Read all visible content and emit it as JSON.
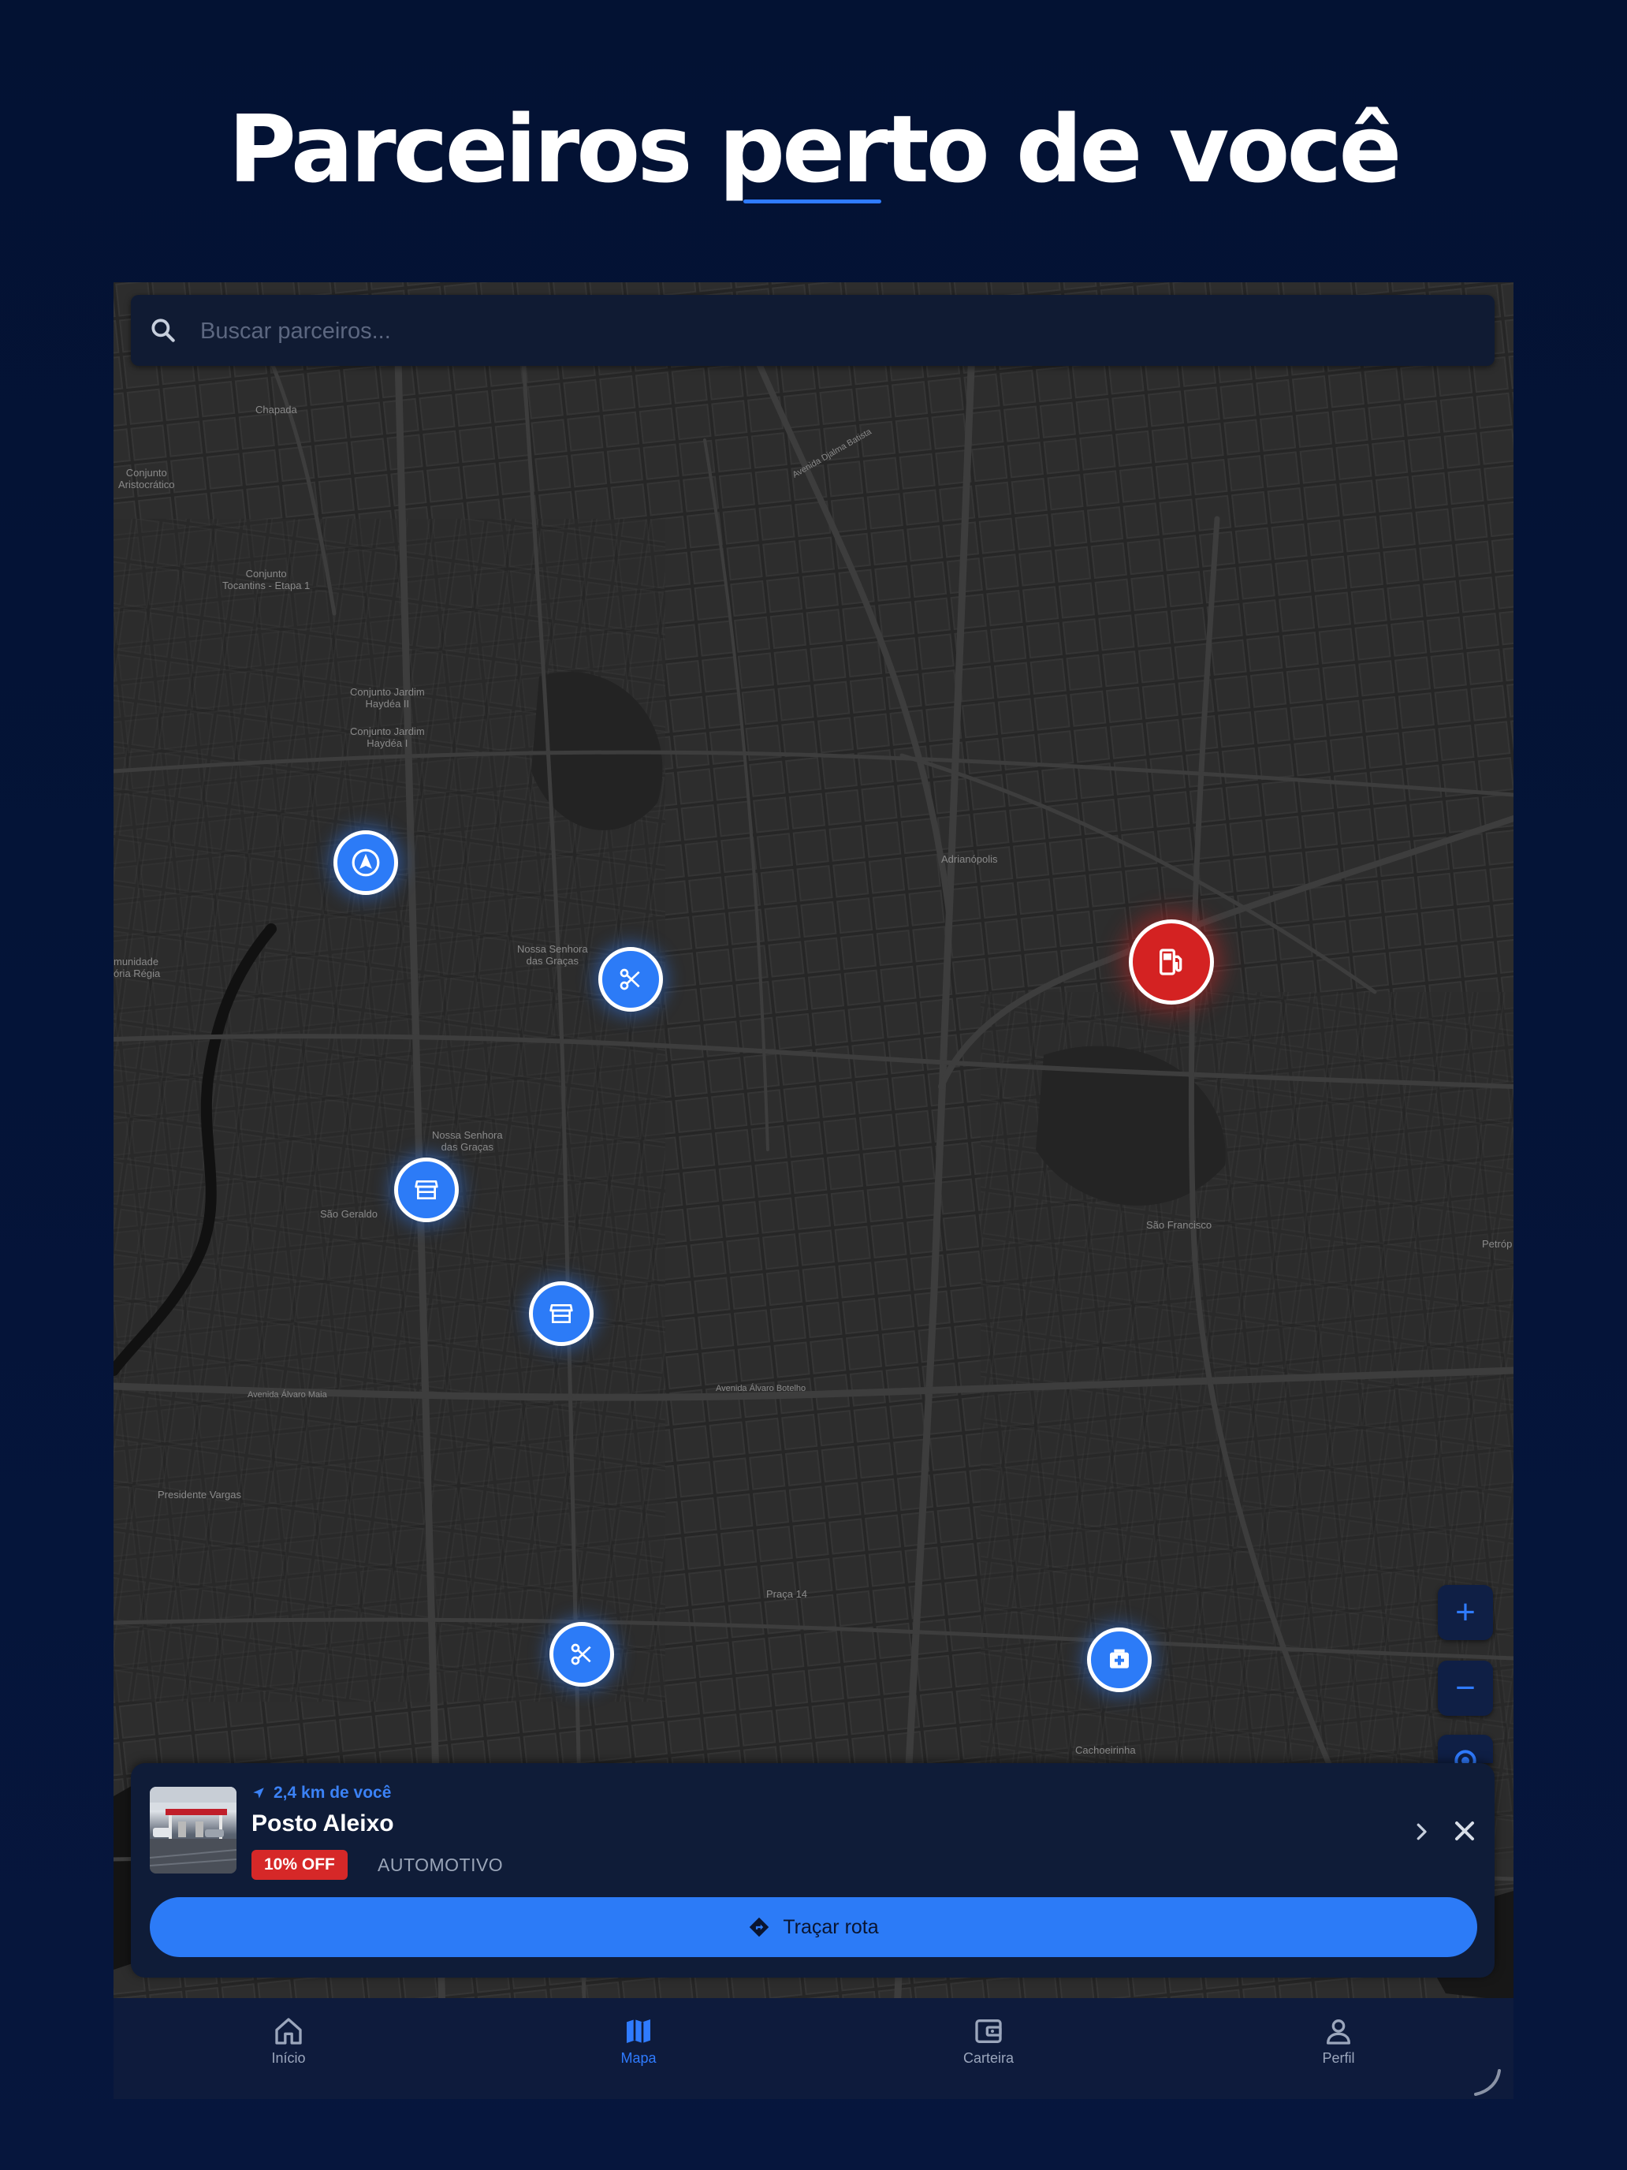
{
  "headline": "Parceiros perto de você",
  "search": {
    "placeholder": "Buscar parceiros..."
  },
  "map_labels": [
    {
      "text": "Chapada"
    },
    {
      "text": "Conjunto\nAristocrático"
    },
    {
      "text": "Conjunto\nTocantins - Etapa 1"
    },
    {
      "text": "Conjunto Jardim\nHaydéa II"
    },
    {
      "text": "Conjunto Jardim\nHaydéa I"
    },
    {
      "text": "Adrianópolis"
    },
    {
      "text": "Nossa Senhora\ndas Graças"
    },
    {
      "text": "Nossa Senhora\ndas Graças"
    },
    {
      "text": "São Geraldo"
    },
    {
      "text": "São Francisco"
    },
    {
      "text": "Presidente Vargas"
    },
    {
      "text": "Praça 14"
    },
    {
      "text": "Cachoeirinha"
    },
    {
      "text": "munidade\nória Régia"
    },
    {
      "text": "Petróp"
    },
    {
      "text": "Avenida Álvaro Maia"
    },
    {
      "text": "Avenida Álvaro Botelho"
    },
    {
      "text": "Avenida Djalma Batista"
    }
  ],
  "pins": [
    {
      "icon": "navigation-icon",
      "color": "#2c7bf7"
    },
    {
      "icon": "scissors-icon",
      "color": "#2c7bf7"
    },
    {
      "icon": "fuel-pump-icon",
      "color": "#d42222"
    },
    {
      "icon": "storefront-icon",
      "color": "#2c7bf7"
    },
    {
      "icon": "storefront-icon",
      "color": "#2c7bf7"
    },
    {
      "icon": "scissors-icon",
      "color": "#2c7bf7"
    },
    {
      "icon": "pharmacy-icon",
      "color": "#2c7bf7"
    }
  ],
  "map_controls": {
    "zoom_in": "+",
    "zoom_out": "−"
  },
  "partner_card": {
    "distance": "2,4 km de você",
    "name": "Posto Aleixo",
    "discount": "10% OFF",
    "category": "AUTOMOTIVO",
    "route_button": "Traçar rota"
  },
  "nav": {
    "items": [
      {
        "label": "Início",
        "icon": "home-icon",
        "active": false
      },
      {
        "label": "Mapa",
        "icon": "map-icon",
        "active": true
      },
      {
        "label": "Carteira",
        "icon": "wallet-icon",
        "active": false
      },
      {
        "label": "Perfil",
        "icon": "person-icon",
        "active": false
      }
    ]
  },
  "colors": {
    "background": "#031233",
    "accent": "#2c7bf7",
    "danger": "#d42222",
    "card": "#0f1c38",
    "map": "#262626"
  }
}
